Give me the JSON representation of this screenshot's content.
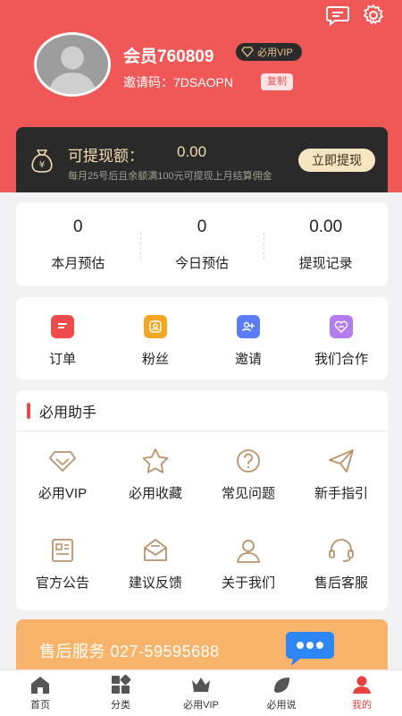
{
  "profile": {
    "member_name": "会员760809",
    "vip_badge": "必用VIP",
    "invite_label": "邀请码：",
    "invite_code": "7DSAOPN",
    "copy_label": "复制"
  },
  "withdraw": {
    "title": "可提现额：",
    "amount": "0.00",
    "note": "每月25号后且余额满100元可提现上月结算佣金",
    "button": "立即提现"
  },
  "stats": [
    {
      "value": "0",
      "label": "本月预估"
    },
    {
      "value": "0",
      "label": "今日预估"
    },
    {
      "value": "0.00",
      "label": "提现记录"
    }
  ],
  "quick_actions": [
    {
      "label": "订单",
      "icon": "order-icon",
      "color": "#f04a4a"
    },
    {
      "label": "粉丝",
      "icon": "fans-icon",
      "color": "#f5a623"
    },
    {
      "label": "邀请",
      "icon": "invite-icon",
      "color": "#5b7cf5"
    },
    {
      "label": "我们合作",
      "icon": "cooperate-icon",
      "color": "#b27cf0"
    }
  ],
  "helper": {
    "title": "必用助手",
    "items": [
      {
        "label": "必用VIP",
        "icon": "diamond-icon"
      },
      {
        "label": "必用收藏",
        "icon": "star-icon"
      },
      {
        "label": "常见问题",
        "icon": "question-icon"
      },
      {
        "label": "新手指引",
        "icon": "paper-plane-icon"
      },
      {
        "label": "官方公告",
        "icon": "notice-icon"
      },
      {
        "label": "建议反馈",
        "icon": "feedback-icon"
      },
      {
        "label": "关于我们",
        "icon": "person-icon"
      },
      {
        "label": "售后客服",
        "icon": "headset-icon"
      }
    ]
  },
  "service": {
    "text": "售后服务  027-59595688"
  },
  "tabs": [
    {
      "label": "首页",
      "icon": "home-icon"
    },
    {
      "label": "分类",
      "icon": "category-icon"
    },
    {
      "label": "必用VIP",
      "icon": "crown-icon"
    },
    {
      "label": "必用说",
      "icon": "leaf-icon"
    },
    {
      "label": "我的",
      "icon": "profile-icon",
      "active": true
    }
  ],
  "colors": {
    "header": "#f05858",
    "accent": "#e8413e",
    "gold_text": "#f3dcae",
    "helper_icon": "#b8936a"
  }
}
